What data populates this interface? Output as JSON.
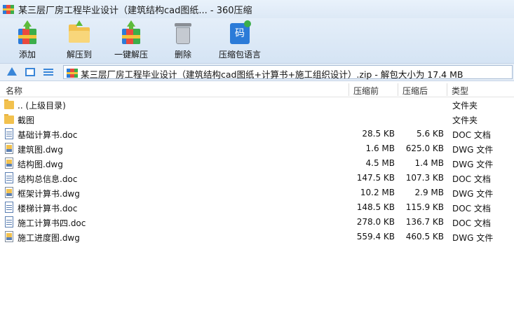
{
  "window": {
    "title": "某三层厂房工程毕业设计（建筑结构cad图纸... - 360压缩"
  },
  "toolbar": {
    "buttons": [
      {
        "label": "添加",
        "icon": "add-archive-icon"
      },
      {
        "label": "解压到",
        "icon": "extract-to-icon"
      },
      {
        "label": "一键解压",
        "icon": "one-click-extract-icon"
      },
      {
        "label": "删除",
        "icon": "trash-icon"
      },
      {
        "label": "压缩包语言",
        "icon": "archive-language-icon"
      }
    ],
    "language_glyph": "码"
  },
  "address": {
    "path": "某三层厂房工程毕业设计（建筑结构cad图纸+计算书+施工组织设计）.zip - 解包大小为 17.4 MB"
  },
  "columns": {
    "name": "名称",
    "compressed": "压缩前",
    "original": "压缩后",
    "type": "类型"
  },
  "rows": [
    {
      "name": ".. (上级目录)",
      "before": "",
      "after": "",
      "type": "文件夹",
      "kind": "folder"
    },
    {
      "name": "截图",
      "before": "",
      "after": "",
      "type": "文件夹",
      "kind": "folder"
    },
    {
      "name": "基础计算书.doc",
      "before": "28.5 KB",
      "after": "5.6 KB",
      "type": "DOC 文档",
      "kind": "doc"
    },
    {
      "name": "建筑图.dwg",
      "before": "1.6 MB",
      "after": "625.0 KB",
      "type": "DWG 文件",
      "kind": "dwg"
    },
    {
      "name": "结构图.dwg",
      "before": "4.5 MB",
      "after": "1.4 MB",
      "type": "DWG 文件",
      "kind": "dwg"
    },
    {
      "name": "结构总信息.doc",
      "before": "147.5 KB",
      "after": "107.3 KB",
      "type": "DOC 文档",
      "kind": "doc"
    },
    {
      "name": "框架计算书.dwg",
      "before": "10.2 MB",
      "after": "2.9 MB",
      "type": "DWG 文件",
      "kind": "dwg"
    },
    {
      "name": "楼梯计算书.doc",
      "before": "148.5 KB",
      "after": "115.9 KB",
      "type": "DOC 文档",
      "kind": "doc"
    },
    {
      "name": "施工计算书四.doc",
      "before": "278.0 KB",
      "after": "136.7 KB",
      "type": "DOC 文档",
      "kind": "doc"
    },
    {
      "name": "施工进度图.dwg",
      "before": "559.4 KB",
      "after": "460.5 KB",
      "type": "DWG 文件",
      "kind": "dwg"
    }
  ]
}
